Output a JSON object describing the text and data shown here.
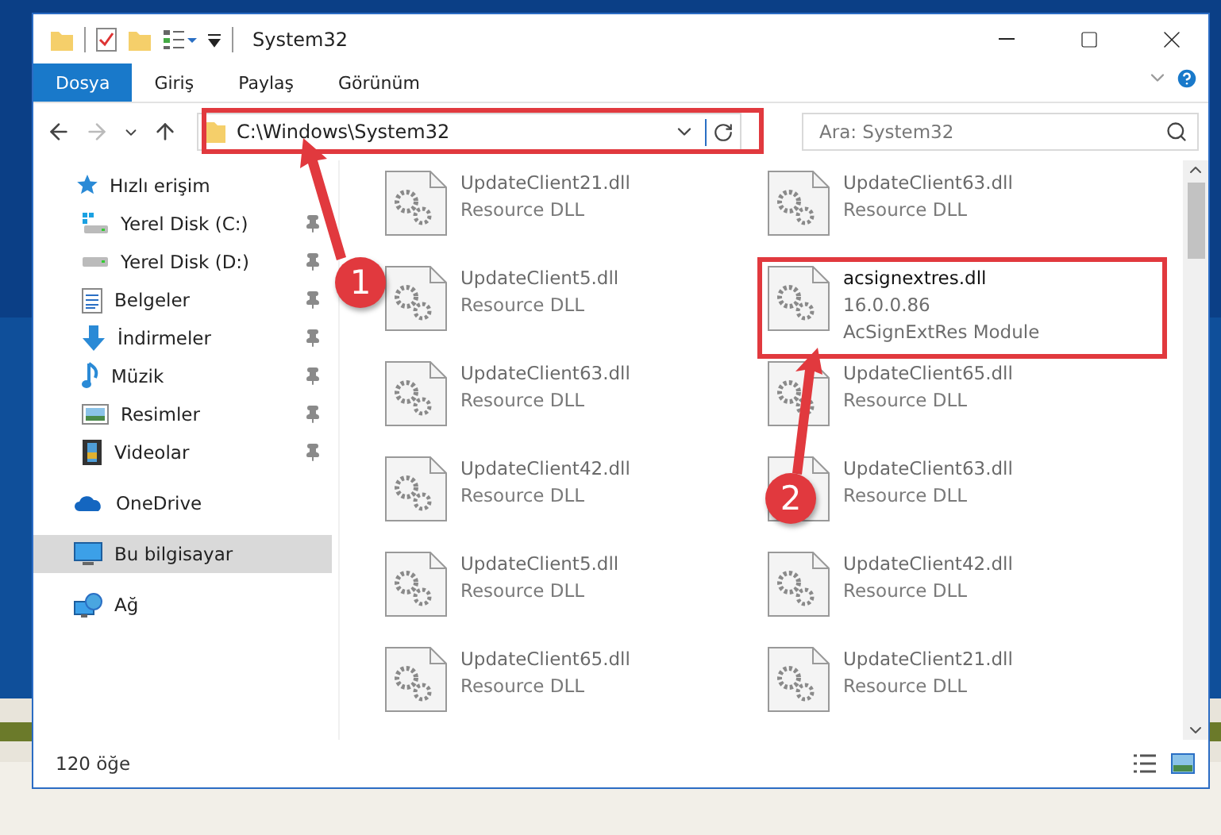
{
  "window": {
    "title": "System32"
  },
  "ribbon_tabs": [
    {
      "label": "Dosya",
      "selected": true
    },
    {
      "label": "Giriş",
      "selected": false
    },
    {
      "label": "Paylaş",
      "selected": false
    },
    {
      "label": "Görünüm",
      "selected": false
    }
  ],
  "address_bar": {
    "path": "C:\\Windows\\System32"
  },
  "search": {
    "placeholder": "Ara: System32"
  },
  "sidebar": {
    "items": [
      {
        "label": "Hızlı erişim",
        "selected": false,
        "children": [
          {
            "label": "Yerel Disk (C:)",
            "pinned": true,
            "selected": false
          },
          {
            "label": "Yerel Disk (D:)",
            "pinned": true,
            "selected": false
          },
          {
            "label": "Belgeler",
            "pinned": true,
            "selected": false
          },
          {
            "label": "İndirmeler",
            "pinned": true,
            "selected": false
          },
          {
            "label": "Müzik",
            "pinned": true,
            "selected": false
          },
          {
            "label": "Resimler",
            "pinned": true,
            "selected": false
          },
          {
            "label": "Videolar",
            "pinned": true,
            "selected": false
          }
        ]
      },
      {
        "label": "OneDrive",
        "selected": false
      },
      {
        "label": "Bu bilgisayar",
        "selected": true
      },
      {
        "label": "Ağ",
        "selected": false
      }
    ]
  },
  "files": [
    {
      "name": "UpdateClient21.dll",
      "lines": [
        "Resource DLL"
      ],
      "faded": true
    },
    {
      "name": "UpdateClient63.dll",
      "lines": [
        "Resource DLL"
      ],
      "faded": true
    },
    {
      "name": "UpdateClient5.dll",
      "lines": [
        "Resource DLL"
      ],
      "faded": true
    },
    {
      "name": "acsignextres.dll",
      "lines": [
        "16.0.0.86",
        "AcSignExtRes Module"
      ],
      "faded": false
    },
    {
      "name": "UpdateClient63.dll",
      "lines": [
        "Resource DLL"
      ],
      "faded": true
    },
    {
      "name": "UpdateClient65.dll",
      "lines": [
        "Resource DLL"
      ],
      "faded": true
    },
    {
      "name": "UpdateClient42.dll",
      "lines": [
        "Resource DLL"
      ],
      "faded": true
    },
    {
      "name": "UpdateClient63.dll",
      "lines": [
        "Resource DLL"
      ],
      "faded": true
    },
    {
      "name": "UpdateClient5.dll",
      "lines": [
        "Resource DLL"
      ],
      "faded": true
    },
    {
      "name": "UpdateClient42.dll",
      "lines": [
        "Resource DLL"
      ],
      "faded": true
    },
    {
      "name": "UpdateClient65.dll",
      "lines": [
        "Resource DLL"
      ],
      "faded": true
    },
    {
      "name": "UpdateClient21.dll",
      "lines": [
        "Resource DLL"
      ],
      "faded": true
    }
  ],
  "status_bar": {
    "item_count": "120 öğe"
  },
  "callouts": [
    {
      "number": "1"
    },
    {
      "number": "2"
    }
  ]
}
